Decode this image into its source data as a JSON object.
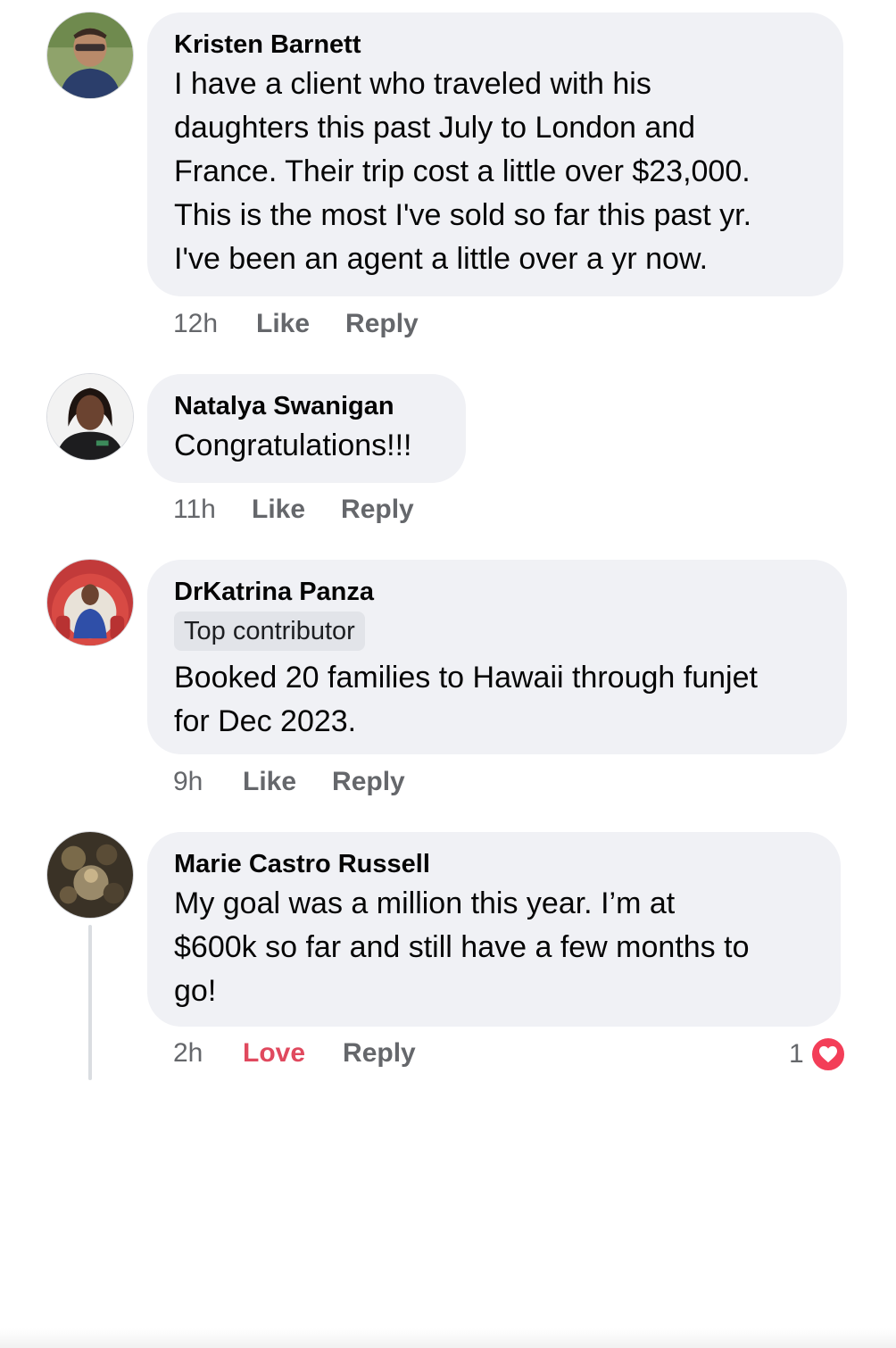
{
  "comments": [
    {
      "author": "Kristen Barnett",
      "text_lines": [
        "I have a client who traveled with his",
        "daughters this past July to London and",
        "France. Their trip cost a little over $23,000.",
        "This is the most I've sold so far this past yr.",
        "I've been an agent a little over a yr now."
      ],
      "time": "12h",
      "reaction_label": "Like",
      "reply_label": "Reply",
      "avatar": "profile-photo"
    },
    {
      "author": "Natalya Swanigan",
      "text_lines": [
        "Congratulations!!!"
      ],
      "time": "11h",
      "reaction_label": "Like",
      "reply_label": "Reply",
      "avatar": "profile-photo"
    },
    {
      "author": "DrKatrina Panza",
      "badge": "Top contributor",
      "text_lines": [
        "Booked 20 families to Hawaii through funjet",
        "for Dec 2023."
      ],
      "time": "9h",
      "reaction_label": "Like",
      "reply_label": "Reply",
      "avatar": "profile-photo"
    },
    {
      "author": "Marie Castro Russell",
      "text_lines": [
        "My goal was a million this year. I’m at",
        "$600k so far and still have a few months to",
        "go!"
      ],
      "time": "2h",
      "reaction_label": "Love",
      "reply_label": "Reply",
      "avatar": "profile-photo",
      "reaction_count": "1",
      "reaction_icon": "heart-icon"
    }
  ],
  "colors": {
    "bubble": "#f0f1f5",
    "meta_text": "#65676b",
    "love": "#e0495e",
    "heart": "#f33e58"
  }
}
